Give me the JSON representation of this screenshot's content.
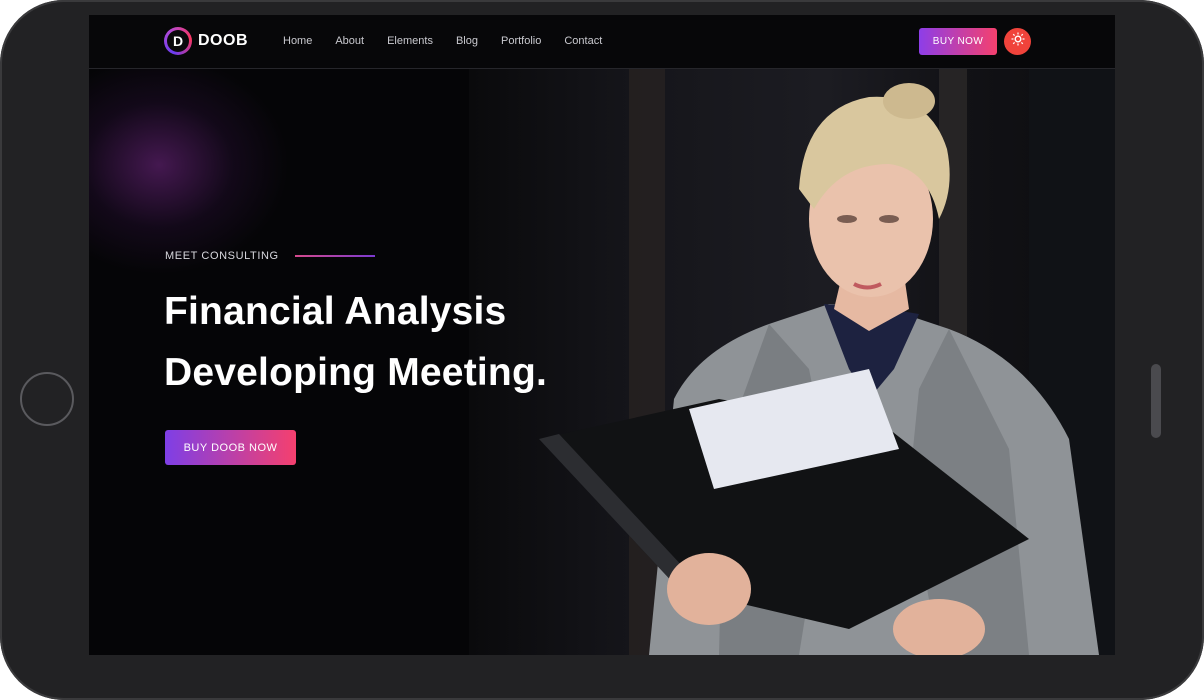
{
  "brand": {
    "logo_letter": "D",
    "name": "DOOB"
  },
  "nav": {
    "items": [
      "Home",
      "About",
      "Elements",
      "Blog",
      "Portfolio",
      "Contact"
    ]
  },
  "header": {
    "buy_label": "BUY NOW",
    "theme_icon": "sun-icon"
  },
  "hero": {
    "subtitle": "MEET CONSULTING",
    "headline_line1": "Financial Analysis",
    "headline_line2": "Developing Meeting.",
    "cta_label": "BUY DOOB NOW"
  },
  "colors": {
    "accent_start": "#8d3ee8",
    "accent_end": "#f5406e",
    "theme_button": "#f0433b",
    "background": "#050507"
  }
}
